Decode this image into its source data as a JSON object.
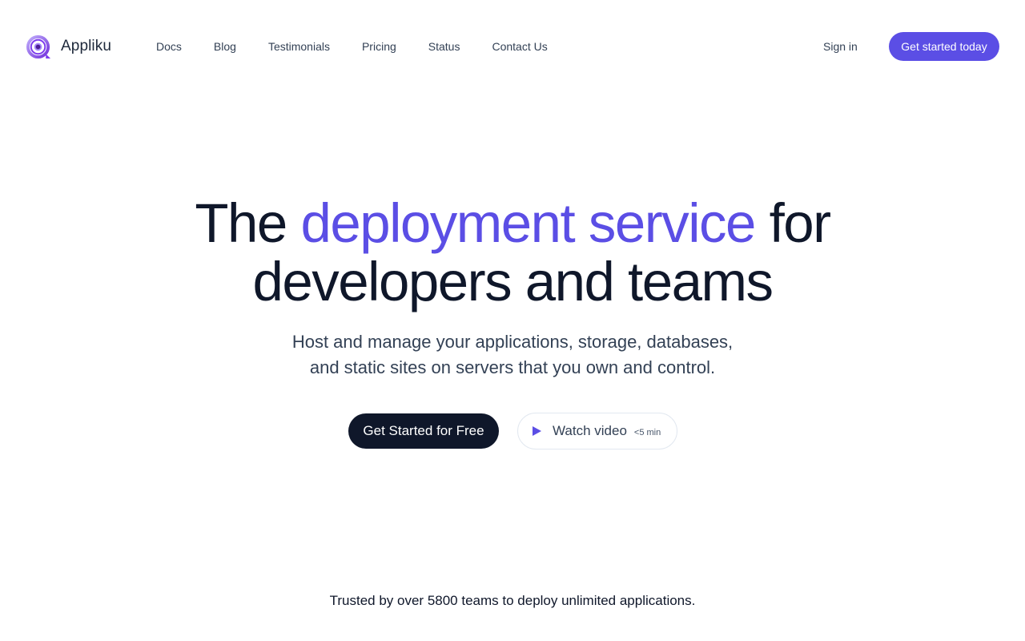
{
  "brand": {
    "name": "Appliku",
    "logo_icon": "appliku-logo-icon",
    "accent_color": "#5b4ee5",
    "dark_color": "#0f172a"
  },
  "nav": {
    "items": [
      {
        "label": "Docs"
      },
      {
        "label": "Blog"
      },
      {
        "label": "Testimonials"
      },
      {
        "label": "Pricing"
      },
      {
        "label": "Status"
      },
      {
        "label": "Contact Us"
      }
    ],
    "sign_in": "Sign in",
    "cta": "Get started today"
  },
  "hero": {
    "title_before": "The ",
    "title_accent": "deployment service",
    "title_after": " for",
    "title_line2": "developers and teams",
    "subtitle_line1": "Host and manage your applications, storage, databases,",
    "subtitle_line2": "and static sites on servers that you own and control.",
    "primary_button": "Get Started for Free",
    "video_button": "Watch video",
    "video_duration": "<5 min",
    "video_icon": "play-icon"
  },
  "trusted": {
    "text": "Trusted by over 5800 teams to deploy unlimited applications."
  }
}
